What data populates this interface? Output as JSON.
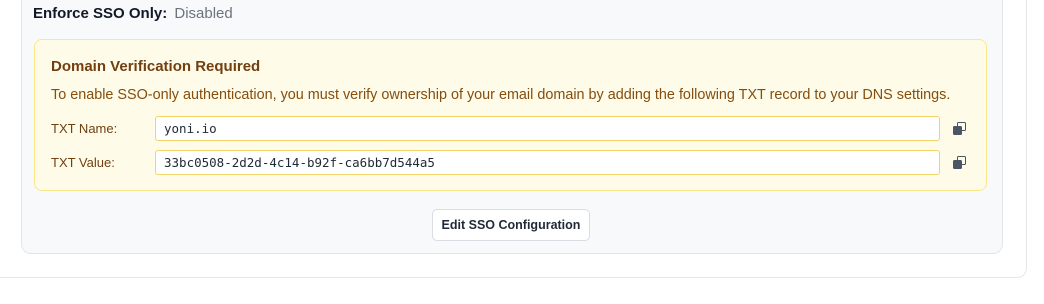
{
  "sso": {
    "enforce_label": "Enforce SSO Only:",
    "enforce_value": "Disabled",
    "edit_button_label": "Edit SSO Configuration"
  },
  "verification": {
    "title": "Domain Verification Required",
    "description": "To enable SSO-only authentication, you must verify ownership of your email domain by adding the following TXT record to your DNS settings.",
    "fields": [
      {
        "label": "TXT Name:",
        "value": "yoni.io",
        "action_icon": "copy-icon"
      },
      {
        "label": "TXT Value:",
        "value": "33bc0508-2d2d-4c14-b92f-ca6bb7d544a5",
        "action_icon": "copy-icon"
      }
    ]
  },
  "colors": {
    "alert_background": "#fefce8",
    "alert_border": "#fde68a",
    "alert_title": "#713f12",
    "alert_text": "#854d0e"
  }
}
